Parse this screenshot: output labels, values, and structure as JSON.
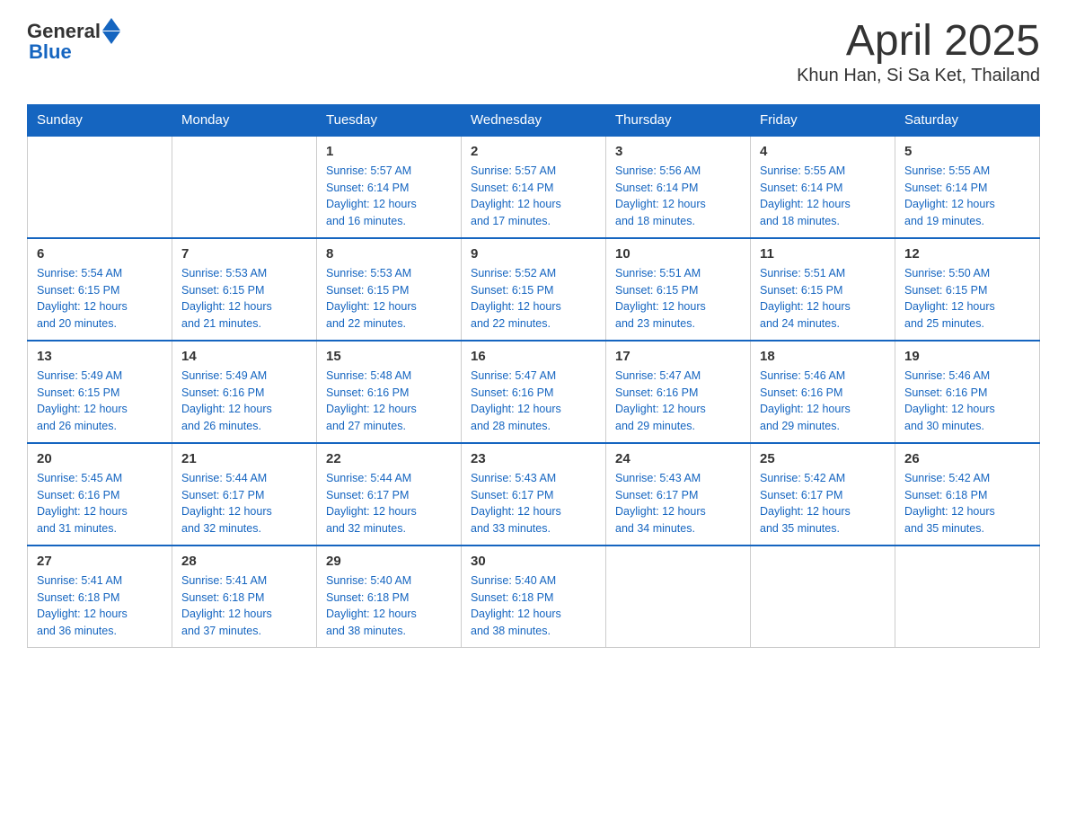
{
  "header": {
    "logo_general": "General",
    "logo_blue": "Blue",
    "title": "April 2025",
    "subtitle": "Khun Han, Si Sa Ket, Thailand"
  },
  "days_of_week": [
    "Sunday",
    "Monday",
    "Tuesday",
    "Wednesday",
    "Thursday",
    "Friday",
    "Saturday"
  ],
  "weeks": [
    [
      {
        "day": "",
        "info": ""
      },
      {
        "day": "",
        "info": ""
      },
      {
        "day": "1",
        "info": "Sunrise: 5:57 AM\nSunset: 6:14 PM\nDaylight: 12 hours\nand 16 minutes."
      },
      {
        "day": "2",
        "info": "Sunrise: 5:57 AM\nSunset: 6:14 PM\nDaylight: 12 hours\nand 17 minutes."
      },
      {
        "day": "3",
        "info": "Sunrise: 5:56 AM\nSunset: 6:14 PM\nDaylight: 12 hours\nand 18 minutes."
      },
      {
        "day": "4",
        "info": "Sunrise: 5:55 AM\nSunset: 6:14 PM\nDaylight: 12 hours\nand 18 minutes."
      },
      {
        "day": "5",
        "info": "Sunrise: 5:55 AM\nSunset: 6:14 PM\nDaylight: 12 hours\nand 19 minutes."
      }
    ],
    [
      {
        "day": "6",
        "info": "Sunrise: 5:54 AM\nSunset: 6:15 PM\nDaylight: 12 hours\nand 20 minutes."
      },
      {
        "day": "7",
        "info": "Sunrise: 5:53 AM\nSunset: 6:15 PM\nDaylight: 12 hours\nand 21 minutes."
      },
      {
        "day": "8",
        "info": "Sunrise: 5:53 AM\nSunset: 6:15 PM\nDaylight: 12 hours\nand 22 minutes."
      },
      {
        "day": "9",
        "info": "Sunrise: 5:52 AM\nSunset: 6:15 PM\nDaylight: 12 hours\nand 22 minutes."
      },
      {
        "day": "10",
        "info": "Sunrise: 5:51 AM\nSunset: 6:15 PM\nDaylight: 12 hours\nand 23 minutes."
      },
      {
        "day": "11",
        "info": "Sunrise: 5:51 AM\nSunset: 6:15 PM\nDaylight: 12 hours\nand 24 minutes."
      },
      {
        "day": "12",
        "info": "Sunrise: 5:50 AM\nSunset: 6:15 PM\nDaylight: 12 hours\nand 25 minutes."
      }
    ],
    [
      {
        "day": "13",
        "info": "Sunrise: 5:49 AM\nSunset: 6:15 PM\nDaylight: 12 hours\nand 26 minutes."
      },
      {
        "day": "14",
        "info": "Sunrise: 5:49 AM\nSunset: 6:16 PM\nDaylight: 12 hours\nand 26 minutes."
      },
      {
        "day": "15",
        "info": "Sunrise: 5:48 AM\nSunset: 6:16 PM\nDaylight: 12 hours\nand 27 minutes."
      },
      {
        "day": "16",
        "info": "Sunrise: 5:47 AM\nSunset: 6:16 PM\nDaylight: 12 hours\nand 28 minutes."
      },
      {
        "day": "17",
        "info": "Sunrise: 5:47 AM\nSunset: 6:16 PM\nDaylight: 12 hours\nand 29 minutes."
      },
      {
        "day": "18",
        "info": "Sunrise: 5:46 AM\nSunset: 6:16 PM\nDaylight: 12 hours\nand 29 minutes."
      },
      {
        "day": "19",
        "info": "Sunrise: 5:46 AM\nSunset: 6:16 PM\nDaylight: 12 hours\nand 30 minutes."
      }
    ],
    [
      {
        "day": "20",
        "info": "Sunrise: 5:45 AM\nSunset: 6:16 PM\nDaylight: 12 hours\nand 31 minutes."
      },
      {
        "day": "21",
        "info": "Sunrise: 5:44 AM\nSunset: 6:17 PM\nDaylight: 12 hours\nand 32 minutes."
      },
      {
        "day": "22",
        "info": "Sunrise: 5:44 AM\nSunset: 6:17 PM\nDaylight: 12 hours\nand 32 minutes."
      },
      {
        "day": "23",
        "info": "Sunrise: 5:43 AM\nSunset: 6:17 PM\nDaylight: 12 hours\nand 33 minutes."
      },
      {
        "day": "24",
        "info": "Sunrise: 5:43 AM\nSunset: 6:17 PM\nDaylight: 12 hours\nand 34 minutes."
      },
      {
        "day": "25",
        "info": "Sunrise: 5:42 AM\nSunset: 6:17 PM\nDaylight: 12 hours\nand 35 minutes."
      },
      {
        "day": "26",
        "info": "Sunrise: 5:42 AM\nSunset: 6:18 PM\nDaylight: 12 hours\nand 35 minutes."
      }
    ],
    [
      {
        "day": "27",
        "info": "Sunrise: 5:41 AM\nSunset: 6:18 PM\nDaylight: 12 hours\nand 36 minutes."
      },
      {
        "day": "28",
        "info": "Sunrise: 5:41 AM\nSunset: 6:18 PM\nDaylight: 12 hours\nand 37 minutes."
      },
      {
        "day": "29",
        "info": "Sunrise: 5:40 AM\nSunset: 6:18 PM\nDaylight: 12 hours\nand 38 minutes."
      },
      {
        "day": "30",
        "info": "Sunrise: 5:40 AM\nSunset: 6:18 PM\nDaylight: 12 hours\nand 38 minutes."
      },
      {
        "day": "",
        "info": ""
      },
      {
        "day": "",
        "info": ""
      },
      {
        "day": "",
        "info": ""
      }
    ]
  ]
}
